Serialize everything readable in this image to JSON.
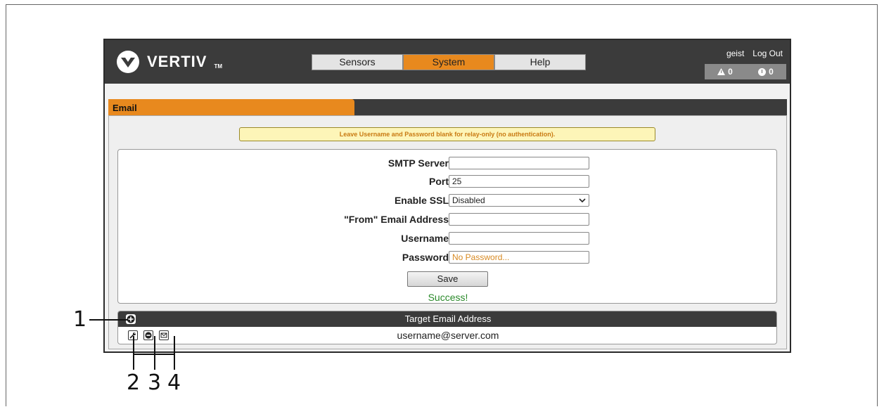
{
  "brand": {
    "name": "VERTIV",
    "tm": "TM"
  },
  "nav": {
    "tabs": [
      {
        "label": "Sensors"
      },
      {
        "label": "System"
      },
      {
        "label": "Help"
      }
    ],
    "active": "System"
  },
  "user": {
    "name": "geist",
    "logout": "Log Out"
  },
  "alerts": {
    "warnings": "0",
    "errors": "0"
  },
  "section": {
    "tab_label": "Email"
  },
  "notice": "Leave Username and Password blank for relay-only (no authentication).",
  "form": {
    "smtp_server": {
      "label": "SMTP Server",
      "value": ""
    },
    "port": {
      "label": "Port",
      "value": "25"
    },
    "enable_ssl": {
      "label": "Enable SSL",
      "value": "Disabled"
    },
    "from_address": {
      "label": "\"From\" Email Address",
      "value": ""
    },
    "username": {
      "label": "Username",
      "value": ""
    },
    "password": {
      "label": "Password",
      "placeholder": "No Password..."
    },
    "save_label": "Save",
    "status": "Success!"
  },
  "targets": {
    "header": "Target Email Address",
    "rows": [
      {
        "email": "username@server.com"
      }
    ]
  },
  "callouts": {
    "c1": "1",
    "c2": "2",
    "c3": "3",
    "c4": "4"
  },
  "colors": {
    "accent": "#e8891e",
    "header_bg": "#3b3b3b",
    "success": "#2a8a2a"
  }
}
